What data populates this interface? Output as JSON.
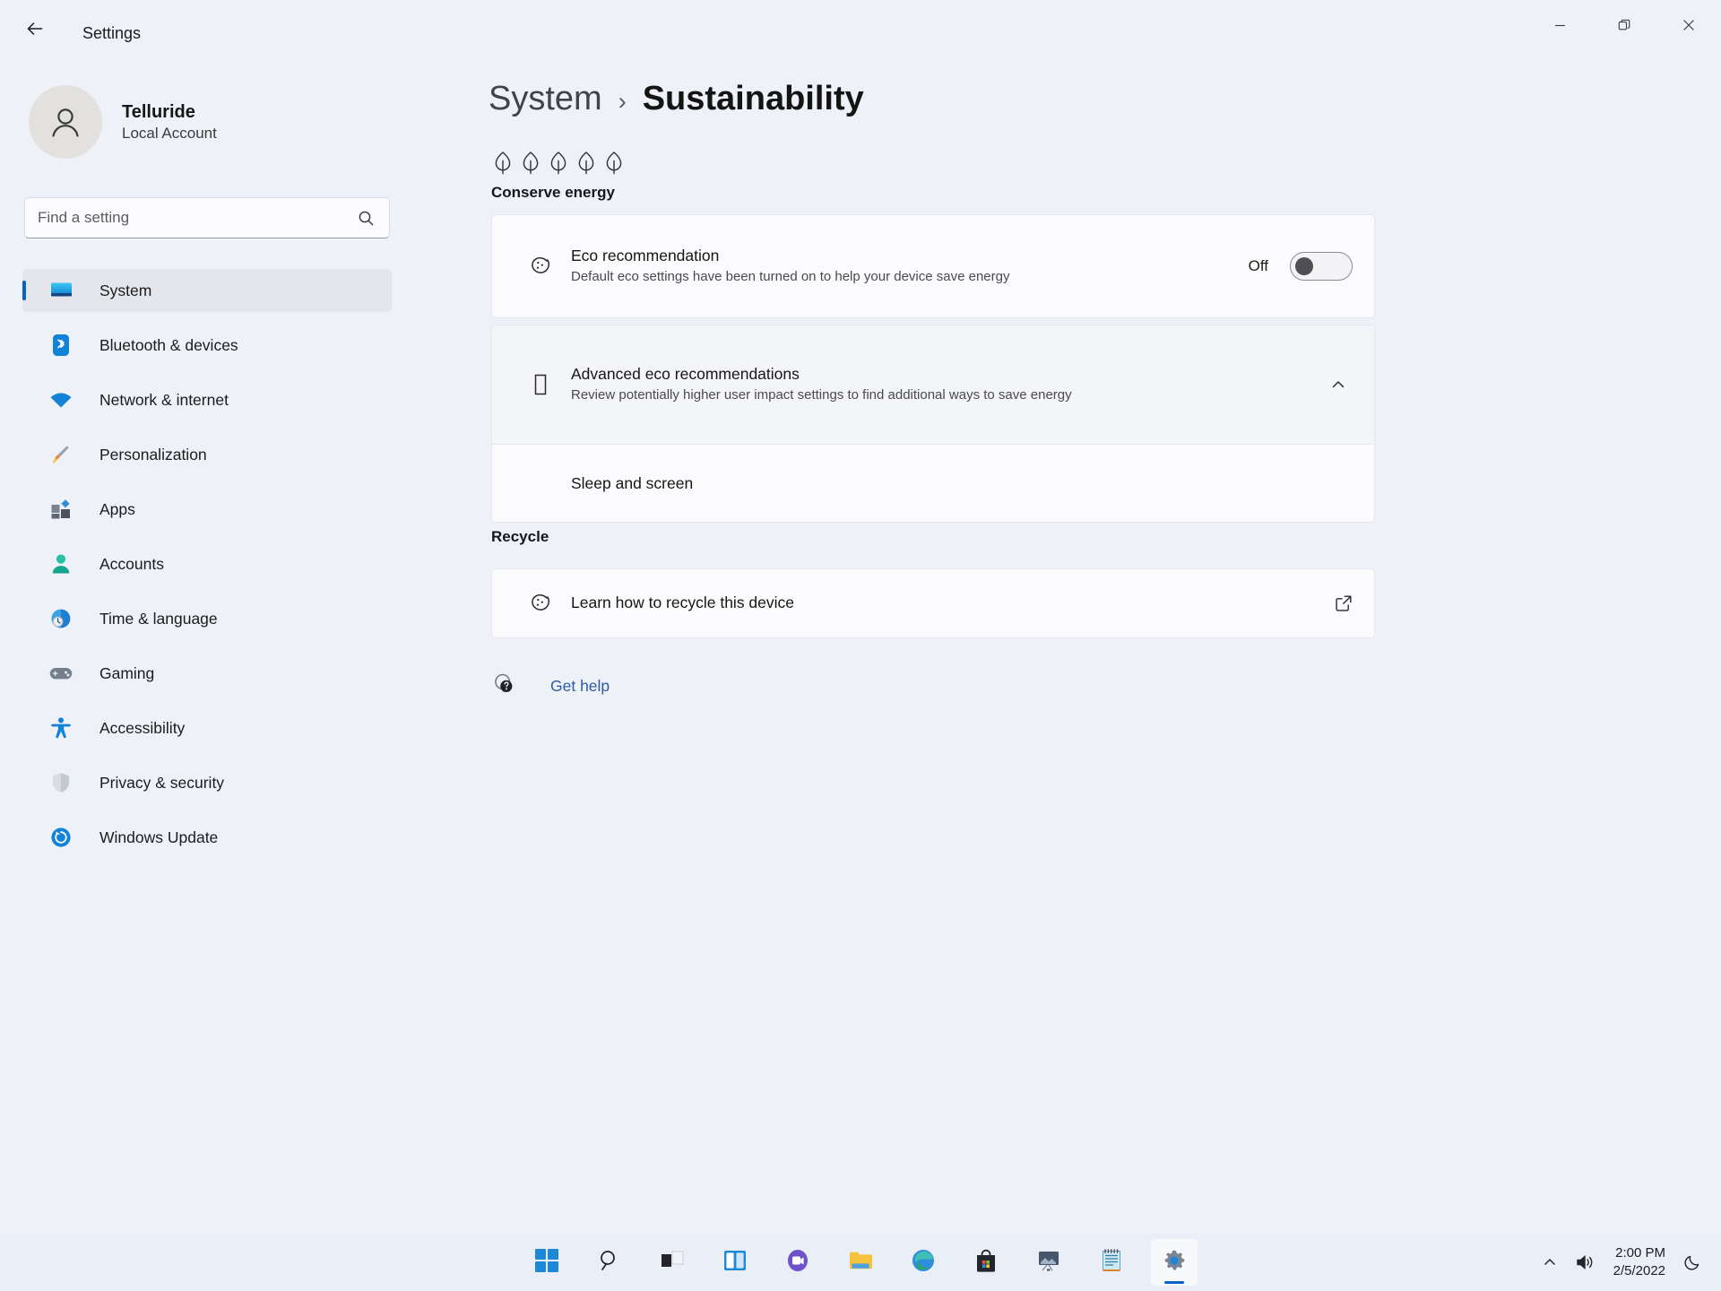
{
  "window": {
    "title": "Settings",
    "back_icon": "back-arrow-icon",
    "controls": [
      {
        "name": "minimize-button",
        "glyph": "minimize-icon"
      },
      {
        "name": "maximize-button",
        "glyph": "restore-icon"
      },
      {
        "name": "close-button",
        "glyph": "close-icon"
      }
    ]
  },
  "sidebar": {
    "account": {
      "name": "Telluride",
      "subtitle": "Local Account",
      "avatar_icon": "person-avatar-icon"
    },
    "search": {
      "placeholder": "Find a setting",
      "value": "",
      "icon": "search-icon"
    },
    "items": [
      {
        "label": "System",
        "icon": "monitor-icon",
        "selected": true
      },
      {
        "label": "Bluetooth & devices",
        "icon": "bluetooth-icon",
        "selected": false
      },
      {
        "label": "Network & internet",
        "icon": "wifi-icon",
        "selected": false
      },
      {
        "label": "Personalization",
        "icon": "paintbrush-icon",
        "selected": false
      },
      {
        "label": "Apps",
        "icon": "apps-icon",
        "selected": false
      },
      {
        "label": "Accounts",
        "icon": "account-person-icon",
        "selected": false
      },
      {
        "label": "Time & language",
        "icon": "clock-globe-icon",
        "selected": false
      },
      {
        "label": "Gaming",
        "icon": "gamepad-icon",
        "selected": false
      },
      {
        "label": "Accessibility",
        "icon": "accessibility-person-icon",
        "selected": false
      },
      {
        "label": "Privacy & security",
        "icon": "shield-icon",
        "selected": false
      },
      {
        "label": "Windows Update",
        "icon": "update-refresh-icon",
        "selected": false
      }
    ]
  },
  "main": {
    "breadcrumb": {
      "parent": "System",
      "separator": "›",
      "current": "Sustainability"
    },
    "conserve": {
      "leaf_count": 5,
      "leaf_icon": "leaf-icon",
      "heading": "Conserve energy",
      "eco": {
        "icon": "eco-leaf-circle-icon",
        "title": "Eco recommendation",
        "description": "Default eco settings have been turned on to help your device save energy",
        "toggle_label": "Off",
        "toggle_state": "off"
      },
      "advanced": {
        "icon": "missing-glyph-icon",
        "title": "Advanced eco recommendations",
        "description": "Review potentially higher user impact settings to find additional ways to save energy",
        "chevron_icon": "chevron-up-icon",
        "expanded": true,
        "sub_items": [
          {
            "label": "Sleep and screen"
          }
        ]
      }
    },
    "recycle": {
      "heading": "Recycle",
      "item": {
        "icon": "eco-leaf-circle-icon",
        "label": "Learn how to recycle this device",
        "external_icon": "external-link-icon"
      }
    },
    "get_help": {
      "label": "Get help",
      "icon": "help-question-icon"
    }
  },
  "taskbar": {
    "buttons": [
      {
        "name": "start-button",
        "icon": "windows-logo-icon",
        "active": false
      },
      {
        "name": "search-button",
        "icon": "search-icon",
        "active": false
      },
      {
        "name": "task-view-button",
        "icon": "task-view-icon",
        "active": false
      },
      {
        "name": "widgets-button",
        "icon": "widgets-icon",
        "active": false
      },
      {
        "name": "chat-button",
        "icon": "chat-teams-icon",
        "active": false
      },
      {
        "name": "file-explorer-button",
        "icon": "folder-icon",
        "active": false
      },
      {
        "name": "edge-button",
        "icon": "edge-browser-icon",
        "active": false
      },
      {
        "name": "store-button",
        "icon": "microsoft-store-icon",
        "active": false
      },
      {
        "name": "photos-button",
        "icon": "photos-app-icon",
        "active": false
      },
      {
        "name": "notepad-button",
        "icon": "notepad-icon",
        "active": false
      },
      {
        "name": "settings-button",
        "icon": "gear-icon",
        "active": true
      }
    ],
    "tray": {
      "chevron_icon": "show-hidden-icons-chevron",
      "volume_icon": "speaker-volume-icon",
      "time": "2:00 PM",
      "date": "2/5/2022",
      "notification_icon": "moon-focus-icon"
    }
  },
  "colors": {
    "accent": "#0a62c9",
    "page_bg": "#eef1f8",
    "card_bg": "#fbfbfd",
    "link": "#2d5ba3"
  }
}
